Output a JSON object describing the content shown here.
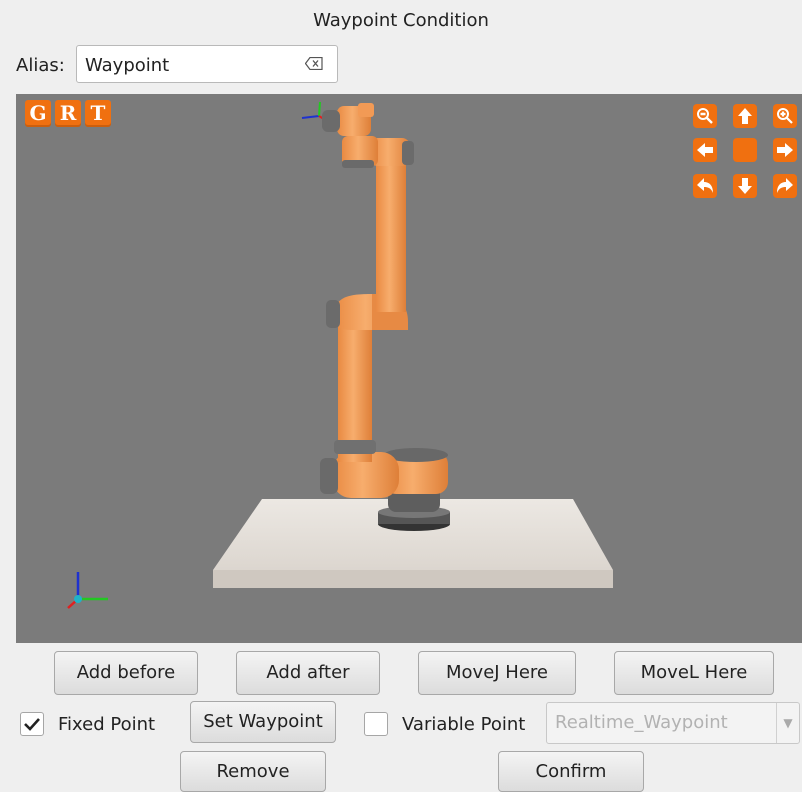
{
  "window": {
    "title": "Waypoint Condition"
  },
  "alias": {
    "label": "Alias:",
    "value": "Waypoint"
  },
  "viewport": {
    "view_buttons": [
      "G",
      "R",
      "T"
    ],
    "colors": {
      "background": "#7b7b7b",
      "robot": "#f4a05c",
      "joint": "#6a6a6a",
      "button": "#f07010"
    },
    "nav_icons": [
      "zoom-out-icon",
      "arrow-up-icon",
      "zoom-in-icon",
      "arrow-left-icon",
      "center-icon",
      "arrow-right-icon",
      "rotate-left-icon",
      "arrow-down-icon",
      "rotate-right-icon"
    ]
  },
  "buttons": {
    "add_before": "Add  before",
    "add_after": "Add after",
    "movej": "MoveJ Here",
    "movel": "MoveL Here",
    "set_waypoint": "Set  Waypoint",
    "remove": "Remove",
    "confirm": "Confirm"
  },
  "fixed_point": {
    "label": "Fixed Point",
    "checked": true
  },
  "variable_point": {
    "label": "Variable Point",
    "checked": false
  },
  "variable_select": {
    "value": "Realtime_Waypoint"
  }
}
